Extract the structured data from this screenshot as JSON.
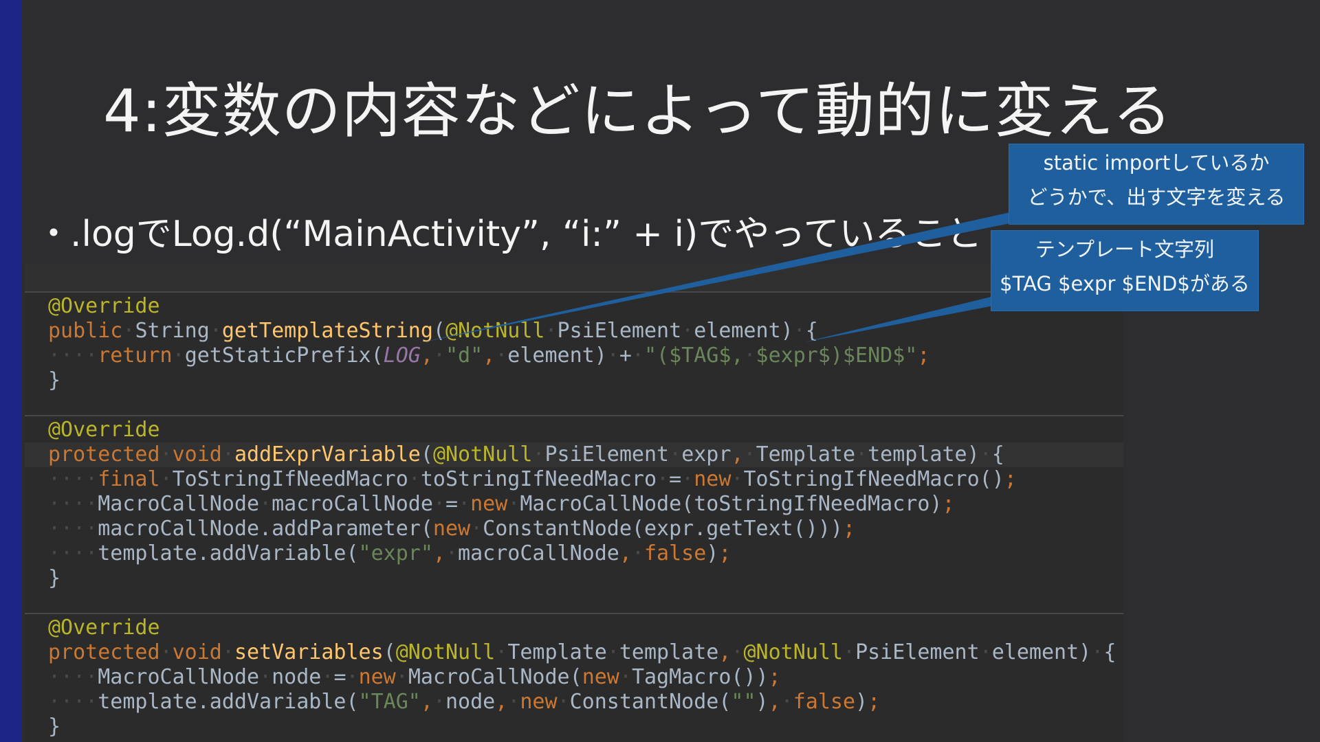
{
  "slide": {
    "title": "4:変数の内容などによって動的に変える",
    "bullet_marker": "・",
    "bullet_text": ".logでLog.d(“MainActivity”, “i:” + i)でやっていること"
  },
  "callouts": [
    {
      "line1": "static importしているか",
      "line2": "どうかで、出す文字を変える"
    },
    {
      "line1": "テンプレート文字列",
      "line2": "$TAG $expr $END$がある"
    }
  ],
  "code": {
    "lines": [
      [
        [
          "annotation",
          "@Override"
        ]
      ],
      [
        [
          "kw",
          "public"
        ],
        [
          "ws",
          "·"
        ],
        [
          "plain",
          "String"
        ],
        [
          "ws",
          "·"
        ],
        [
          "fn",
          "getTemplateString"
        ],
        [
          "plain",
          "("
        ],
        [
          "annotation",
          "@NotNull"
        ],
        [
          "ws",
          "·"
        ],
        [
          "plain",
          "PsiElement"
        ],
        [
          "ws",
          "·"
        ],
        [
          "plain",
          "element)"
        ],
        [
          "ws",
          "·"
        ],
        [
          "plain",
          "{"
        ]
      ],
      [
        [
          "ws",
          "····"
        ],
        [
          "kw",
          "return"
        ],
        [
          "ws",
          "·"
        ],
        [
          "plain",
          "getStaticPrefix("
        ],
        [
          "const",
          "LOG"
        ],
        [
          "kw",
          ","
        ],
        [
          "ws",
          "·"
        ],
        [
          "str",
          "\"d\""
        ],
        [
          "kw",
          ","
        ],
        [
          "ws",
          "·"
        ],
        [
          "plain",
          "element)"
        ],
        [
          "ws",
          "·"
        ],
        [
          "plain",
          "+"
        ],
        [
          "ws",
          "·"
        ],
        [
          "str",
          "\"($TAG$,"
        ],
        [
          "ws",
          "·"
        ],
        [
          "str",
          "$expr$)$END$\""
        ],
        [
          "kw",
          ";"
        ]
      ],
      [
        [
          "plain",
          "}"
        ]
      ],
      [
        [
          "annotation",
          "@Override"
        ]
      ],
      [
        [
          "kw",
          "protected"
        ],
        [
          "ws",
          "·"
        ],
        [
          "kw",
          "void"
        ],
        [
          "ws",
          "·"
        ],
        [
          "fn",
          "addExprVariable"
        ],
        [
          "plain",
          "("
        ],
        [
          "annotation",
          "@NotNull"
        ],
        [
          "ws",
          "·"
        ],
        [
          "plain",
          "PsiElement"
        ],
        [
          "ws",
          "·"
        ],
        [
          "plain",
          "expr"
        ],
        [
          "kw",
          ","
        ],
        [
          "ws",
          "·"
        ],
        [
          "plain",
          "Template"
        ],
        [
          "ws",
          "·"
        ],
        [
          "plain",
          "template)"
        ],
        [
          "ws",
          "·"
        ],
        [
          "plain",
          "{"
        ]
      ],
      [
        [
          "ws",
          "····"
        ],
        [
          "kw",
          "final"
        ],
        [
          "ws",
          "·"
        ],
        [
          "plain",
          "ToStringIfNeedMacro"
        ],
        [
          "ws",
          "·"
        ],
        [
          "plain",
          "toStringIfNeedMacro"
        ],
        [
          "ws",
          "·"
        ],
        [
          "plain",
          "="
        ],
        [
          "ws",
          "·"
        ],
        [
          "kw",
          "new"
        ],
        [
          "ws",
          "·"
        ],
        [
          "plain",
          "ToStringIfNeedMacro()"
        ],
        [
          "kw",
          ";"
        ]
      ],
      [
        [
          "ws",
          "····"
        ],
        [
          "plain",
          "MacroCallNode"
        ],
        [
          "ws",
          "·"
        ],
        [
          "plain",
          "macroCallNode"
        ],
        [
          "ws",
          "·"
        ],
        [
          "plain",
          "="
        ],
        [
          "ws",
          "·"
        ],
        [
          "kw",
          "new"
        ],
        [
          "ws",
          "·"
        ],
        [
          "plain",
          "MacroCallNode(toStringIfNeedMacro)"
        ],
        [
          "kw",
          ";"
        ]
      ],
      [
        [
          "ws",
          "····"
        ],
        [
          "plain",
          "macroCallNode.addParameter("
        ],
        [
          "kw",
          "new"
        ],
        [
          "ws",
          "·"
        ],
        [
          "plain",
          "ConstantNode(expr.getText()))"
        ],
        [
          "kw",
          ";"
        ]
      ],
      [
        [
          "ws",
          "····"
        ],
        [
          "plain",
          "template.addVariable("
        ],
        [
          "str",
          "\"expr\""
        ],
        [
          "kw",
          ","
        ],
        [
          "ws",
          "·"
        ],
        [
          "plain",
          "macroCallNode"
        ],
        [
          "kw",
          ","
        ],
        [
          "ws",
          "·"
        ],
        [
          "kw",
          "false"
        ],
        [
          "plain",
          ")"
        ],
        [
          "kw",
          ";"
        ]
      ],
      [
        [
          "plain",
          "}"
        ]
      ],
      [
        [
          "annotation",
          "@Override"
        ]
      ],
      [
        [
          "kw",
          "protected"
        ],
        [
          "ws",
          "·"
        ],
        [
          "kw",
          "void"
        ],
        [
          "ws",
          "·"
        ],
        [
          "fn",
          "setVariables"
        ],
        [
          "plain",
          "("
        ],
        [
          "annotation",
          "@NotNull"
        ],
        [
          "ws",
          "·"
        ],
        [
          "plain",
          "Template"
        ],
        [
          "ws",
          "·"
        ],
        [
          "plain",
          "template"
        ],
        [
          "kw",
          ","
        ],
        [
          "ws",
          "·"
        ],
        [
          "annotation",
          "@NotNull"
        ],
        [
          "ws",
          "·"
        ],
        [
          "plain",
          "PsiElement"
        ],
        [
          "ws",
          "·"
        ],
        [
          "plain",
          "element)"
        ],
        [
          "ws",
          "·"
        ],
        [
          "plain",
          "{"
        ]
      ],
      [
        [
          "ws",
          "····"
        ],
        [
          "plain",
          "MacroCallNode"
        ],
        [
          "ws",
          "·"
        ],
        [
          "plain",
          "node"
        ],
        [
          "ws",
          "·"
        ],
        [
          "plain",
          "="
        ],
        [
          "ws",
          "·"
        ],
        [
          "kw",
          "new"
        ],
        [
          "ws",
          "·"
        ],
        [
          "plain",
          "MacroCallNode("
        ],
        [
          "kw",
          "new"
        ],
        [
          "ws",
          "·"
        ],
        [
          "plain",
          "TagMacro())"
        ],
        [
          "kw",
          ";"
        ]
      ],
      [
        [
          "ws",
          "····"
        ],
        [
          "plain",
          "template.addVariable("
        ],
        [
          "str",
          "\"TAG\""
        ],
        [
          "kw",
          ","
        ],
        [
          "ws",
          "·"
        ],
        [
          "plain",
          "node"
        ],
        [
          "kw",
          ","
        ],
        [
          "ws",
          "·"
        ],
        [
          "kw",
          "new"
        ],
        [
          "ws",
          "·"
        ],
        [
          "plain",
          "ConstantNode("
        ],
        [
          "str",
          "\"\""
        ],
        [
          "plain",
          ")"
        ],
        [
          "kw",
          ","
        ],
        [
          "ws",
          "·"
        ],
        [
          "kw",
          "false"
        ],
        [
          "plain",
          ")"
        ],
        [
          "kw",
          ";"
        ]
      ],
      [
        [
          "plain",
          "}"
        ]
      ]
    ]
  },
  "colors": {
    "background": "#2d2d2f",
    "left_bar": "#1d2586",
    "callout": "#1f5f9d",
    "annotation": "#bbb529",
    "keyword": "#cc7832",
    "method": "#ffc66d",
    "string": "#6a8759",
    "constant": "#9876aa",
    "text": "#a9b7c6"
  }
}
